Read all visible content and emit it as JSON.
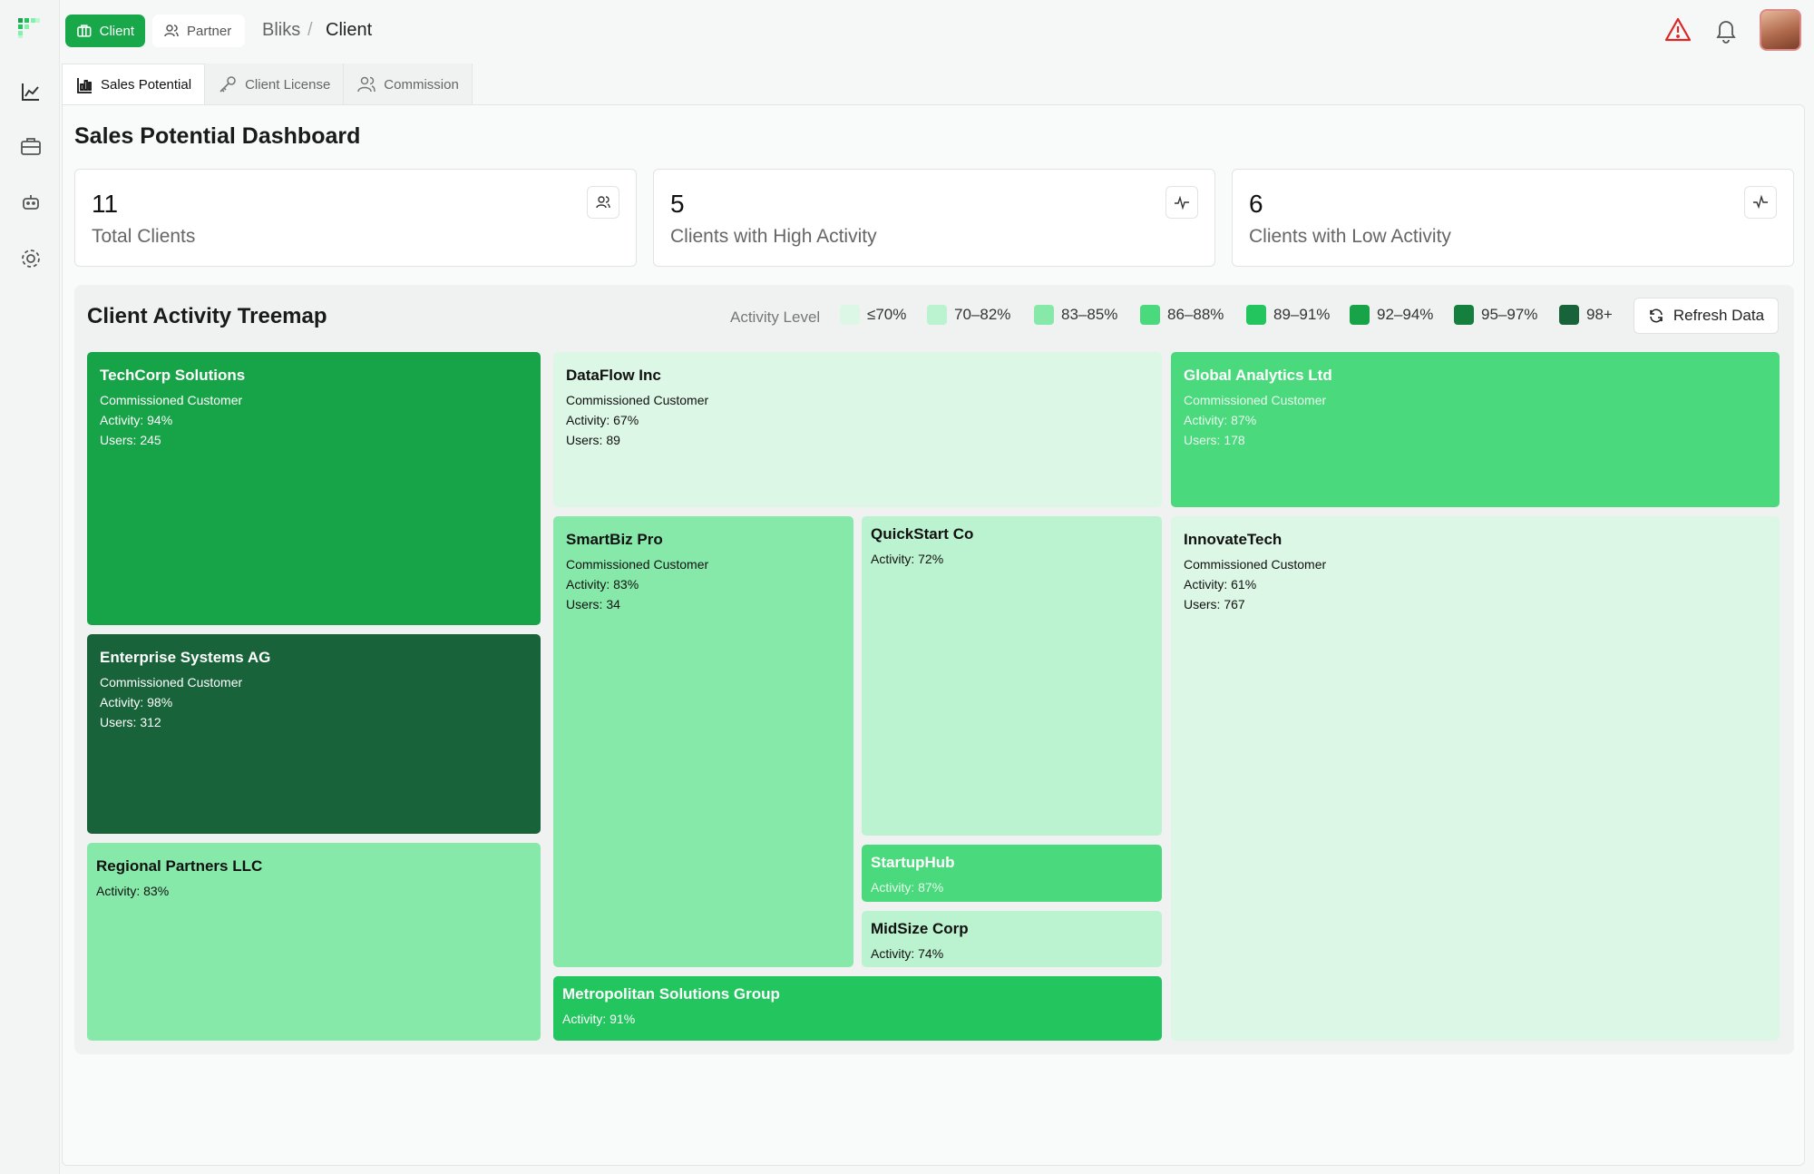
{
  "nav": {
    "client_label": "Client",
    "partner_label": "Partner",
    "breadcrumb": [
      "Bliks",
      "/",
      "Client"
    ]
  },
  "tabs": [
    {
      "label": "Sales Potential",
      "icon": "bar-chart-icon",
      "active": true
    },
    {
      "label": "Client License",
      "icon": "key-icon",
      "active": false
    },
    {
      "label": "Commission",
      "icon": "users-icon",
      "active": false
    }
  ],
  "dashboard": {
    "title": "Sales Potential Dashboard",
    "stats": [
      {
        "value": "11",
        "label": "Total Clients",
        "icon": "users-icon"
      },
      {
        "value": "5",
        "label": "Clients with High Activity",
        "icon": "activity-icon"
      },
      {
        "value": "6",
        "label": "Clients with Low Activity",
        "icon": "activity-low-icon"
      }
    ]
  },
  "treemap": {
    "title": "Client Activity Treemap",
    "legend_label": "Activity Level",
    "legend": [
      {
        "label": "≤70%",
        "color": "#dcf7e5"
      },
      {
        "label": "70–82%",
        "color": "#bbf2cf"
      },
      {
        "label": "83–85%",
        "color": "#86e9a9"
      },
      {
        "label": "86–88%",
        "color": "#4ad97c"
      },
      {
        "label": "89–91%",
        "color": "#22c55e"
      },
      {
        "label": "92–94%",
        "color": "#17a347"
      },
      {
        "label": "95–97%",
        "color": "#15803d"
      },
      {
        "label": "98+",
        "color": "#18633a"
      }
    ],
    "refresh_label": "Refresh Data",
    "clients": [
      {
        "name": "TechCorp Solutions",
        "type": "Commissioned Customer",
        "activity": "Activity: 94%",
        "users": "Users: 245",
        "color": "#17a347"
      },
      {
        "name": "Enterprise Systems AG",
        "type": "Commissioned Customer",
        "activity": "Activity: 98%",
        "users": "Users: 312",
        "color": "#18633a"
      },
      {
        "name": "Regional Partners LLC",
        "type": "",
        "activity": "Activity: 83%",
        "users": "",
        "color": "#86e9a9"
      },
      {
        "name": "DataFlow Inc",
        "type": "Commissioned Customer",
        "activity": "Activity: 67%",
        "users": "Users: 89",
        "color": "#dcf7e5"
      },
      {
        "name": "SmartBiz Pro",
        "type": "Commissioned Customer",
        "activity": "Activity: 83%",
        "users": "Users: 34",
        "color": "#86e9a9"
      },
      {
        "name": "QuickStart Co",
        "type": "",
        "activity": "Activity: 72%",
        "users": "",
        "color": "#bbf2cf"
      },
      {
        "name": "StartupHub",
        "type": "",
        "activity": "Activity: 87%",
        "users": "",
        "color": "#4ad97c"
      },
      {
        "name": "MidSize Corp",
        "type": "",
        "activity": "Activity: 74%",
        "users": "",
        "color": "#bbf2cf"
      },
      {
        "name": "Metropolitan Solutions Group",
        "type": "",
        "activity": "Activity: 91%",
        "users": "",
        "color": "#22c55e"
      },
      {
        "name": "Global Analytics Ltd",
        "type": "Commissioned Customer",
        "activity": "Activity: 87%",
        "users": "Users: 178",
        "color": "#4ad97c"
      },
      {
        "name": "InnovateTech",
        "type": "Commissioned Customer",
        "activity": "Activity: 61%",
        "users": "Users: 767",
        "color": "#dcf7e5"
      }
    ]
  }
}
